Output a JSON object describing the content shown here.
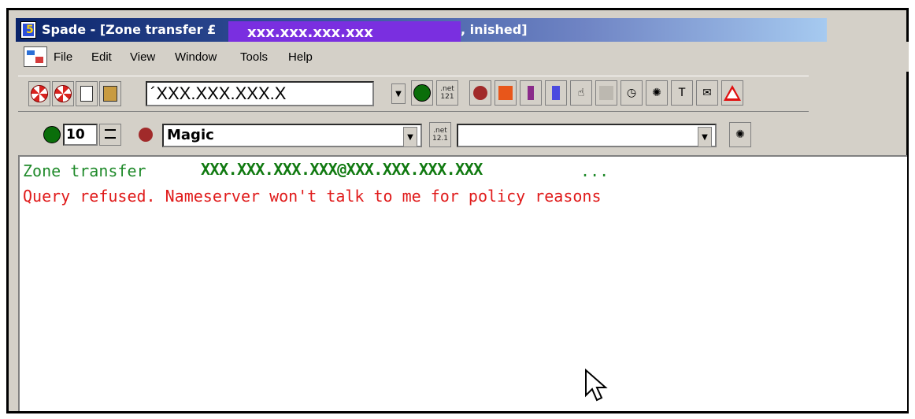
{
  "window": {
    "app_icon": "spade-app-icon",
    "title_prefix": "Spade - [Zone transfer £",
    "title_target": "xxx.xxx.xxx.xxx",
    "title_suffix": ", inished]"
  },
  "menu": {
    "icon": "document-icon",
    "items": [
      "File",
      "Edit",
      "View",
      "Window",
      "Tools",
      "Help"
    ]
  },
  "toolbar1": {
    "address_value": "´XXX.XXX.XXX.X",
    "net_label_top": ".net",
    "net_label_bottom": "121",
    "icons": [
      "lifebuoy-icon",
      "lifebuoy-icon",
      "copy-icon",
      "paste-icon",
      "dropdown-arrow-icon",
      "green-circle-icon",
      "net-icon",
      "animal-icon",
      "flag-icon",
      "tool-icon",
      "network-icon",
      "hand-icon",
      "disabled-icon",
      "clock-icon",
      "spider-icon",
      "text-icon",
      "mail-icon",
      "warning-triangle-icon"
    ]
  },
  "toolbar2": {
    "spin_value": "10",
    "select_value": "Magic",
    "net_label_top": ".net",
    "net_label_bottom": "12.1",
    "second_select_value": ""
  },
  "output": {
    "line1_prefix": "Zone transfer ",
    "line1_target": "XXX.XXX.XXX.XXX@XXX.XXX.XXX.XXX",
    "line1_suffix": " ...",
    "line2": "Query refused. Nameserver won't talk to me for policy reasons",
    "colors": {
      "info": "#1f8a2a",
      "error": "#e01b1b"
    }
  }
}
